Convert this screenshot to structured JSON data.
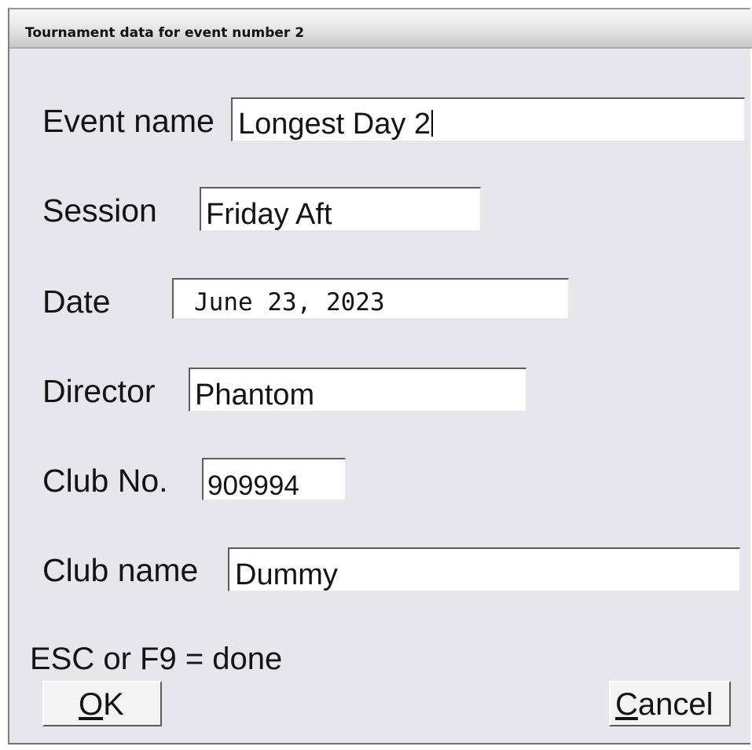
{
  "window": {
    "title": "Tournament data for event number 2"
  },
  "form": {
    "event_name": {
      "label": "Event name",
      "value": "Longest Day 2"
    },
    "session": {
      "label": "Session",
      "value": "Friday Aft"
    },
    "date": {
      "label": "Date",
      "value": "June 23, 2023"
    },
    "director": {
      "label": "Director",
      "value": "Phantom"
    },
    "club_no": {
      "label": "Club No.",
      "value": "909994"
    },
    "club_name": {
      "label": "Club name",
      "value": "Dummy"
    }
  },
  "hint": "ESC or F9 = done",
  "buttons": {
    "ok": {
      "mnemonic": "O",
      "rest": "K"
    },
    "cancel": {
      "mnemonic": "C",
      "rest": "ancel"
    }
  }
}
